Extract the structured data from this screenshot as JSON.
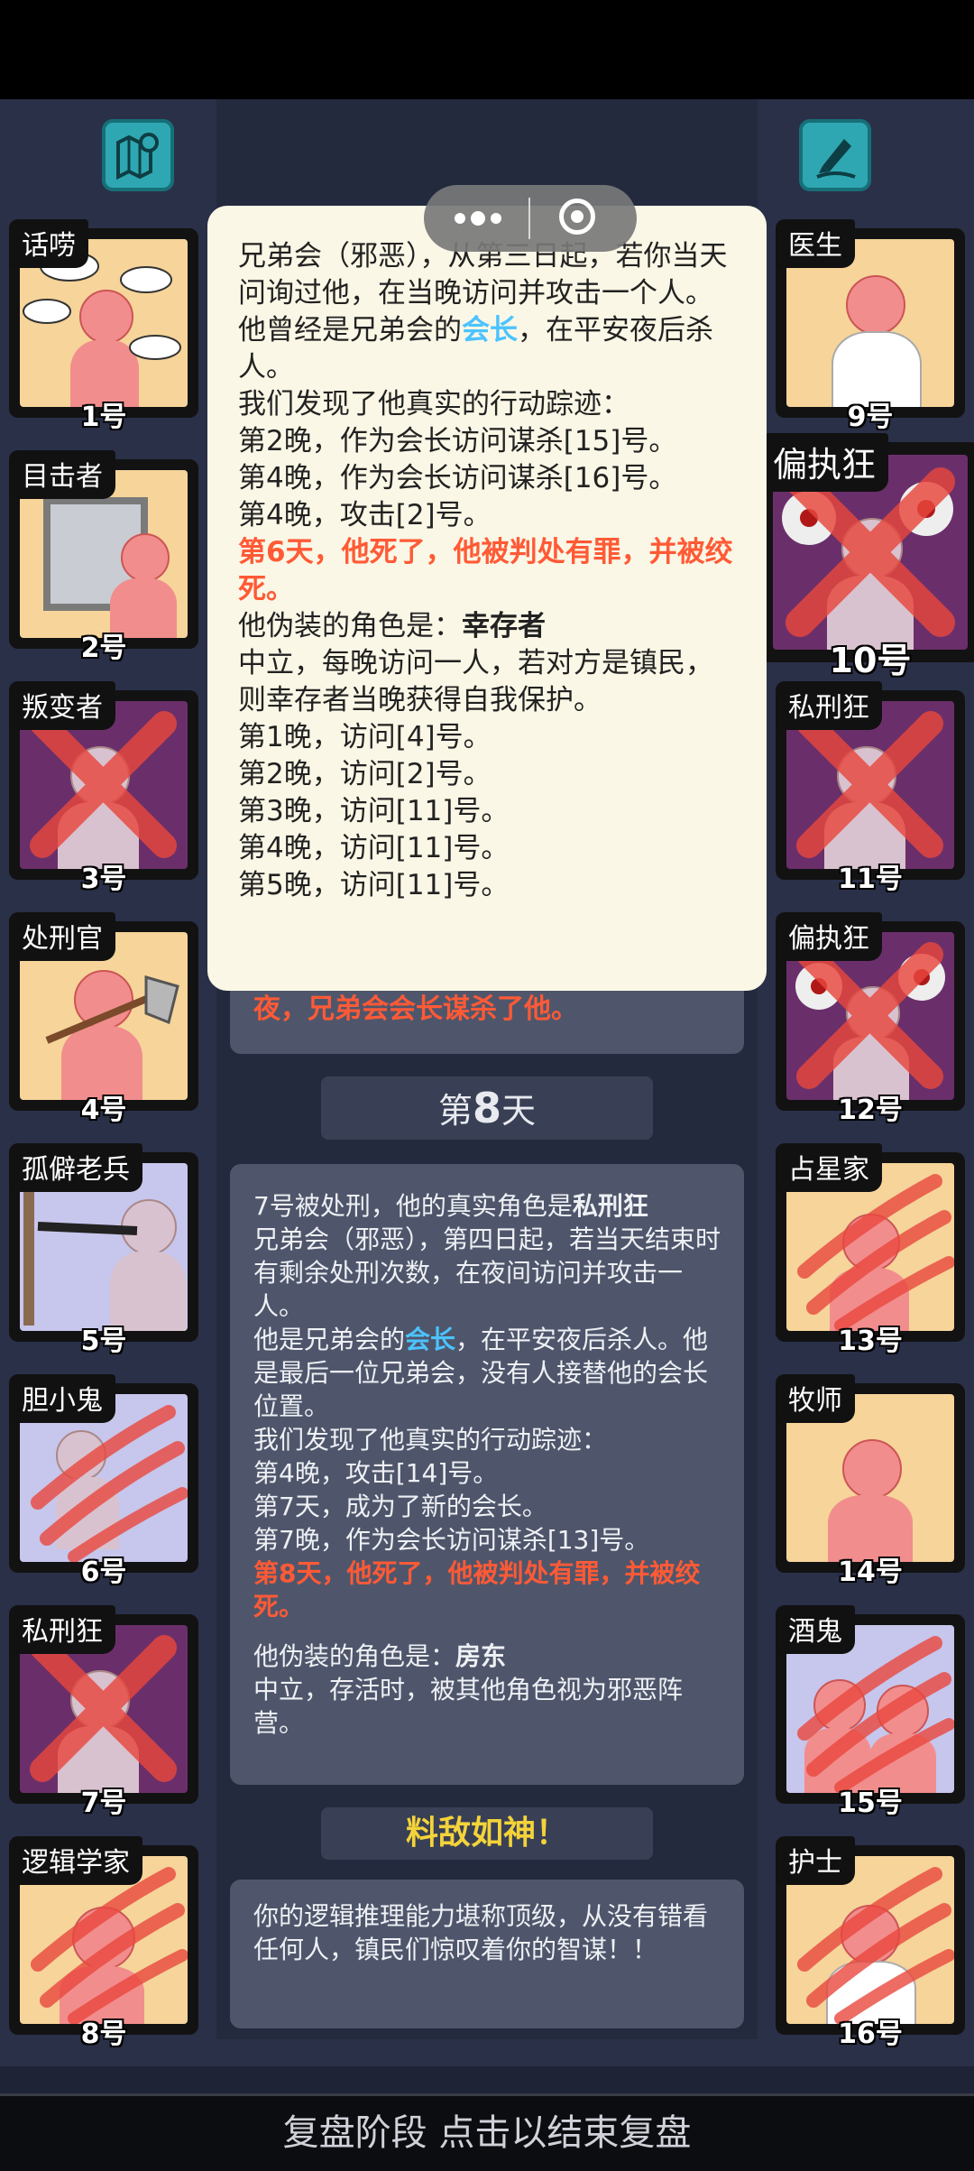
{
  "players": [
    {
      "number": "1号",
      "role": "话唠"
    },
    {
      "number": "2号",
      "role": "目击者"
    },
    {
      "number": "3号",
      "role": "叛变者"
    },
    {
      "number": "4号",
      "role": "处刑官"
    },
    {
      "number": "5号",
      "role": "孤僻老兵"
    },
    {
      "number": "6号",
      "role": "胆小鬼"
    },
    {
      "number": "7号",
      "role": "私刑狂"
    },
    {
      "number": "8号",
      "role": "逻辑学家"
    },
    {
      "number": "9号",
      "role": "医生"
    },
    {
      "number": "10号",
      "role": "偏执狂"
    },
    {
      "number": "11号",
      "role": "私刑狂"
    },
    {
      "number": "12号",
      "role": "偏执狂"
    },
    {
      "number": "13号",
      "role": "占星家"
    },
    {
      "number": "14号",
      "role": "牧师"
    },
    {
      "number": "15号",
      "role": "酒鬼"
    },
    {
      "number": "16号",
      "role": "护士"
    }
  ],
  "icons": {
    "left_button": "map-pin-icon",
    "right_button": "pencil-edit-icon"
  },
  "popup": {
    "line1": "兄弟会（邪恶），从第三日起，若你当天问询过他，在当晚访问并攻击一个人。",
    "line2_a": "他曾经是兄弟会的",
    "line2_b": "会长",
    "line2_c": "，在平安夜后杀人。",
    "line3": "我们发现了他真实的行动踪迹：",
    "line4": "第2晚，作为会长访问谋杀[15]号。",
    "line5": "第4晚，作为会长访问谋杀[16]号。",
    "line6": "第4晚，攻击[2]号。",
    "line7": "第6天，他死了，他被判处有罪，并被绞死。",
    "line8_a": "他伪装的角色是：",
    "line8_b": "幸存者",
    "line9": "中立，每晚访问一人，若对方是镇民，则幸存者当晚获得自我保护。",
    "line10": "第1晚，访问[4]号。",
    "line11": "第2晚，访问[2]号。",
    "line12": "第3晚，访问[11]号。",
    "line13": "第4晚，访问[11]号。",
    "line14": "第5晚，访问[11]号。"
  },
  "prev_snippet": "夜，兄弟会会长谋杀了他。",
  "day": {
    "prefix": "第",
    "number": "8",
    "suffix": "天"
  },
  "day8": {
    "l1_a": "7号被处刑，他的真实角色是",
    "l1_b": "私刑狂",
    "l2": "兄弟会（邪恶），第四日起，若当天结束时有剩余处刑次数，在夜间访问并攻击一人。",
    "l3_a": "他是兄弟会的",
    "l3_b": "会长",
    "l3_c": "，在平安夜后杀人。他是最后一位兄弟会，没有人接替他的会长位置。",
    "l4": "我们发现了他真实的行动踪迹：",
    "l5": "第4晚，攻击[14]号。",
    "l6": "第7天，成为了新的会长。",
    "l7": "第7晚，作为会长访问谋杀[13]号。",
    "l8": "第8天，他死了，他被判处有罪，并被绞死。",
    "l9_a": "他伪装的角色是：",
    "l9_b": "房东",
    "l10": "中立，存活时，被其他角色视为邪恶阵营。"
  },
  "praise": {
    "title": "料敌如神！",
    "text": "你的逻辑推理能力堪称顶级，从没有错看任何人，镇民们惊叹着你的智谋！！"
  },
  "bottom_bar": "复盘阶段 点击以结束复盘",
  "colors": {
    "accent_red": "#ff5a36",
    "accent_blue": "#4cc3ff",
    "gold": "#f4d33a",
    "teal": "#2fa7b2"
  }
}
